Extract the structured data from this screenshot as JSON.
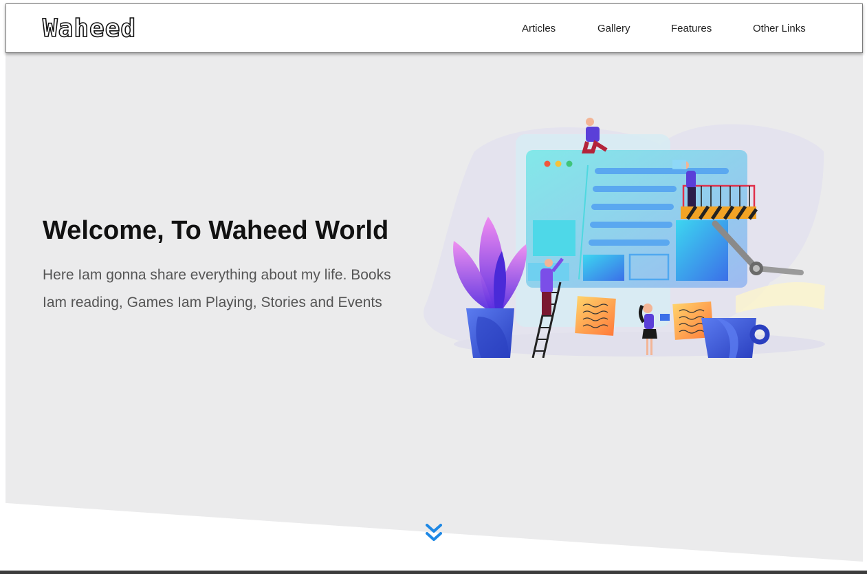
{
  "header": {
    "logo": "Waheed",
    "nav": [
      {
        "label": "Articles"
      },
      {
        "label": "Gallery"
      },
      {
        "label": "Features"
      },
      {
        "label": "Other Links"
      }
    ]
  },
  "hero": {
    "title": "Welcome, To Waheed World",
    "text": "Here Iam gonna share everything about my life. Books Iam reading, Games Iam Playing, Stories and Events",
    "background_color": "#ebebec"
  },
  "scroll_hint": {
    "icon": "double-chevron-down-icon",
    "color": "#1e88e5"
  },
  "illustration": {
    "icon": "website-building-illustration"
  }
}
